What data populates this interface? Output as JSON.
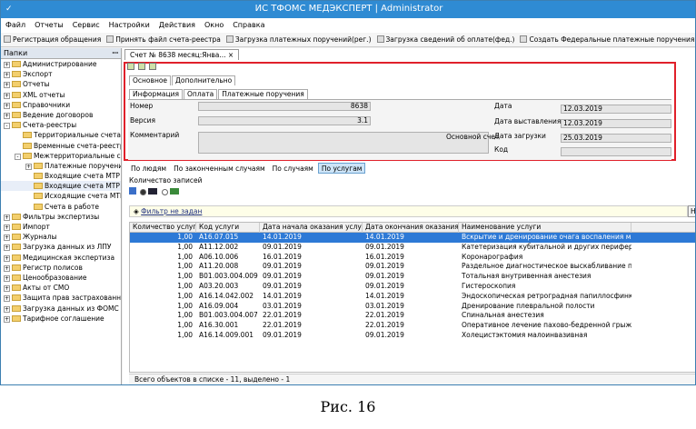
{
  "window": {
    "title": "ИС ТФОМС МЕДЭКСПЕРТ | Administrator"
  },
  "menu": [
    "Файл",
    "Отчеты",
    "Сервис",
    "Настройки",
    "Действия",
    "Окно",
    "Справка"
  ],
  "toolbar": [
    "Регистрация обращения",
    "Принять файл счета-реестра",
    "Загрузка платежных поручений(рег.)",
    "Загрузка сведений об оплате(фед.)",
    "Создать Федеральные платежные поручения",
    "Загрузить акт экспертиз"
  ],
  "leftpane": {
    "title": "Папки",
    "pin": "ꟷ"
  },
  "tree": [
    {
      "label": "Администрирование",
      "pm": "+",
      "lvl": 0
    },
    {
      "label": "Экспорт",
      "pm": "+",
      "lvl": 0
    },
    {
      "label": "Отчеты",
      "pm": "+",
      "lvl": 0
    },
    {
      "label": "XML отчеты",
      "pm": "+",
      "lvl": 0
    },
    {
      "label": "Справочники",
      "pm": "+",
      "lvl": 0
    },
    {
      "label": "Ведение договоров",
      "pm": "+",
      "lvl": 0
    },
    {
      "label": "Счета-реестры",
      "pm": "-",
      "lvl": 0
    },
    {
      "label": "Территориальные счета-р",
      "pm": "",
      "lvl": 1
    },
    {
      "label": "Временные счета-реестры",
      "pm": "",
      "lvl": 1
    },
    {
      "label": "Межтерриториальные сч",
      "pm": "-",
      "lvl": 1
    },
    {
      "label": "Платежные поручения",
      "pm": "+",
      "lvl": 2
    },
    {
      "label": "Входящие счета МТР с",
      "pm": "",
      "lvl": 2
    },
    {
      "label": "Входящие счета МТР с",
      "pm": "",
      "lvl": 2
    },
    {
      "label": "Исходящие счета МТР",
      "pm": "",
      "lvl": 2
    },
    {
      "label": "Счета в работе",
      "pm": "",
      "lvl": 2
    },
    {
      "label": "Фильтры экспертизы",
      "pm": "+",
      "lvl": 0
    },
    {
      "label": "Импорт",
      "pm": "+",
      "lvl": 0
    },
    {
      "label": "Журналы",
      "pm": "+",
      "lvl": 0
    },
    {
      "label": "Загрузка данных из ЛПУ",
      "pm": "+",
      "lvl": 0
    },
    {
      "label": "Медицинская экспертиза",
      "pm": "+",
      "lvl": 0
    },
    {
      "label": "Регистр полисов",
      "pm": "+",
      "lvl": 0
    },
    {
      "label": "Ценообразование",
      "pm": "+",
      "lvl": 0
    },
    {
      "label": "Акты от СМО",
      "pm": "+",
      "lvl": 0
    },
    {
      "label": "Защита прав застрахованных",
      "pm": "+",
      "lvl": 0
    },
    {
      "label": "Загрузка данных из ФОМС",
      "pm": "+",
      "lvl": 0
    },
    {
      "label": "Тарифное соглашение",
      "pm": "+",
      "lvl": 0
    }
  ],
  "doc": {
    "tab": "Счет № 8638 месяц:Янва...  ×"
  },
  "tabs1": [
    "Основное",
    "Дополнительно"
  ],
  "tabs2": [
    "Информация",
    "Оплата",
    "Платежные поручения"
  ],
  "form": {
    "nomer_lbl": "Номер",
    "nomer": "8638",
    "versiya_lbl": "Версия",
    "versiya": "3.1",
    "komm_lbl": "Комментарий",
    "osn_lbl": "Основной счет",
    "data_lbl": "Дата",
    "data": "12.03.2019",
    "datav_lbl": "Дата выставления",
    "datav": "12.03.2019",
    "datazag_lbl": "Дата загрузки",
    "datazag": "25.03.2019",
    "kod_lbl": "Код",
    "kod": ""
  },
  "subtabs": [
    "По людям",
    "По законченным случаям",
    "По случаям",
    "По услугам"
  ],
  "count_label": "Количество записей",
  "filter": {
    "text": "Фильтр не задан",
    "btn": "На"
  },
  "grid": {
    "headers": [
      "Количество услуг",
      "Код услуги",
      "Дата начала оказания услуги",
      "Дата окончания оказания у...",
      "Наименование услуги"
    ],
    "rows": [
      [
        "1,00",
        "A16.07.015",
        "14.01.2019",
        "14.01.2019",
        "Вскрытие и дренирование очага воспаления мягких тка..."
      ],
      [
        "1,00",
        "A11.12.002",
        "09.01.2019",
        "09.01.2019",
        "Катетеризация кубитальной и других периферических вен"
      ],
      [
        "1,00",
        "A06.10.006",
        "16.01.2019",
        "16.01.2019",
        "Коронарография"
      ],
      [
        "1,00",
        "A11.20.008",
        "09.01.2019",
        "09.01.2019",
        "Раздельное диагностическое выскабливание полости ..."
      ],
      [
        "1,00",
        "B01.003.004.009",
        "09.01.2019",
        "09.01.2019",
        "Тотальная внутривенная анестезия"
      ],
      [
        "1,00",
        "A03.20.003",
        "09.01.2019",
        "09.01.2019",
        "Гистероскопия"
      ],
      [
        "1,00",
        "A16.14.042.002",
        "14.01.2019",
        "14.01.2019",
        "Эндоскопическая ретроградная папиллосфинктеротомия"
      ],
      [
        "1,00",
        "A16.09.004",
        "03.01.2019",
        "03.01.2019",
        "Дренирование плевральной полости"
      ],
      [
        "1,00",
        "B01.003.004.007",
        "22.01.2019",
        "22.01.2019",
        "Спинальная анестезия"
      ],
      [
        "1,00",
        "A16.30.001",
        "22.01.2019",
        "22.01.2019",
        "Оперативное лечение пахово-бедренной грыжи"
      ],
      [
        "1,00",
        "A16.14.009.001",
        "09.01.2019",
        "09.01.2019",
        "Холецистэктомия малоинвазивная"
      ]
    ]
  },
  "status": "Всего объектов в списке - 11, выделено - 1",
  "caption": "Рис. 16"
}
